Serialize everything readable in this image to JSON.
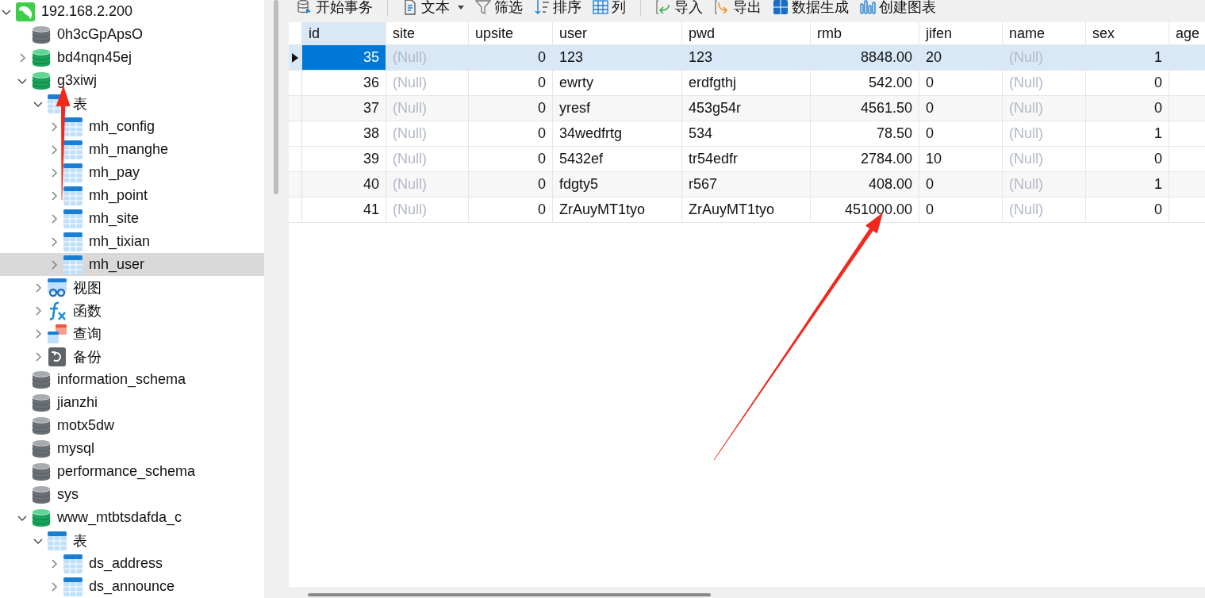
{
  "tree": [
    {
      "label": "192.168.2.200",
      "kind": "server",
      "expanded": true,
      "selected": false,
      "children": [
        {
          "label": "0h3cGpApsO",
          "kind": "database",
          "open": false,
          "selected": false
        },
        {
          "label": "bd4nqn45ej",
          "kind": "database",
          "open": true,
          "expanded": false,
          "selected": false
        },
        {
          "label": "g3xiwj",
          "kind": "database",
          "open": true,
          "expanded": true,
          "selected": false,
          "children": [
            {
              "label": "表",
              "kind": "tables",
              "expanded": true,
              "selected": false,
              "children": [
                {
                  "label": "mh_config",
                  "kind": "table",
                  "expanded": false,
                  "selected": false
                },
                {
                  "label": "mh_manghe",
                  "kind": "table",
                  "expanded": false,
                  "selected": false
                },
                {
                  "label": "mh_pay",
                  "kind": "table",
                  "expanded": false,
                  "selected": false
                },
                {
                  "label": "mh_point",
                  "kind": "table",
                  "expanded": false,
                  "selected": false
                },
                {
                  "label": "mh_site",
                  "kind": "table",
                  "expanded": false,
                  "selected": false
                },
                {
                  "label": "mh_tixian",
                  "kind": "table",
                  "expanded": false,
                  "selected": false
                },
                {
                  "label": "mh_user",
                  "kind": "table",
                  "expanded": false,
                  "selected": true
                }
              ]
            },
            {
              "label": "视图",
              "kind": "views",
              "expanded": false,
              "selected": false
            },
            {
              "label": "函数",
              "kind": "functions",
              "expanded": false,
              "selected": false
            },
            {
              "label": "查询",
              "kind": "queries",
              "expanded": false,
              "selected": false
            },
            {
              "label": "备份",
              "kind": "backups",
              "expanded": false,
              "selected": false
            }
          ]
        },
        {
          "label": "information_schema",
          "kind": "database",
          "open": false,
          "selected": false
        },
        {
          "label": "jianzhi",
          "kind": "database",
          "open": false,
          "selected": false
        },
        {
          "label": "motx5dw",
          "kind": "database",
          "open": false,
          "selected": false
        },
        {
          "label": "mysql",
          "kind": "database",
          "open": false,
          "selected": false
        },
        {
          "label": "performance_schema",
          "kind": "database",
          "open": false,
          "selected": false
        },
        {
          "label": "sys",
          "kind": "database",
          "open": false,
          "selected": false
        },
        {
          "label": "www_mtbtsdafda_c",
          "kind": "database",
          "open": true,
          "expanded": true,
          "selected": false,
          "children": [
            {
              "label": "表",
              "kind": "tables",
              "expanded": true,
              "selected": false,
              "children": [
                {
                  "label": "ds_address",
                  "kind": "table",
                  "expanded": false,
                  "selected": false
                },
                {
                  "label": "ds_announce",
                  "kind": "table",
                  "expanded": false,
                  "selected": false
                }
              ]
            }
          ]
        }
      ]
    }
  ],
  "toolbar": [
    {
      "buttons": [
        {
          "label": "开始事务",
          "kind": "transaction",
          "dropdown": false
        }
      ]
    },
    {
      "buttons": [
        {
          "label": "文本",
          "kind": "text",
          "dropdown": true
        },
        {
          "label": "筛选",
          "kind": "filter",
          "dropdown": false
        },
        {
          "label": "排序",
          "kind": "sort",
          "dropdown": false
        },
        {
          "label": "列",
          "kind": "columns",
          "dropdown": false
        }
      ]
    },
    {
      "buttons": [
        {
          "label": "导入",
          "kind": "import",
          "dropdown": false
        },
        {
          "label": "导出",
          "kind": "export",
          "dropdown": false
        },
        {
          "label": "数据生成",
          "kind": "generate",
          "dropdown": false
        },
        {
          "label": "创建图表",
          "kind": "chart",
          "dropdown": false
        }
      ]
    }
  ],
  "table": {
    "columns": [
      {
        "label": "id",
        "kind": "numeric",
        "selected": true
      },
      {
        "label": "site",
        "kind": "text",
        "selected": false
      },
      {
        "label": "upsite",
        "kind": "numeric",
        "selected": false
      },
      {
        "label": "user",
        "kind": "text",
        "selected": false
      },
      {
        "label": "pwd",
        "kind": "text",
        "selected": false
      },
      {
        "label": "rmb",
        "kind": "numeric",
        "selected": false
      },
      {
        "label": "jifen",
        "kind": "text",
        "selected": false
      },
      {
        "label": "name",
        "kind": "text",
        "selected": false
      },
      {
        "label": "sex",
        "kind": "numeric",
        "selected": false
      },
      {
        "label": "age",
        "kind": "text",
        "selected": false
      }
    ],
    "rows": [
      {
        "selected": true,
        "cells": [
          {
            "text": "35",
            "null": false
          },
          {
            "text": "(Null)",
            "null": true
          },
          {
            "text": "0",
            "null": false
          },
          {
            "text": "123",
            "null": false
          },
          {
            "text": "123",
            "null": false
          },
          {
            "text": "8848.00",
            "null": false
          },
          {
            "text": "20",
            "null": false
          },
          {
            "text": "(Null)",
            "null": true
          },
          {
            "text": "1",
            "null": false
          }
        ]
      },
      {
        "selected": false,
        "cells": [
          {
            "text": "36",
            "null": false
          },
          {
            "text": "(Null)",
            "null": true
          },
          {
            "text": "0",
            "null": false
          },
          {
            "text": "ewrty",
            "null": false
          },
          {
            "text": "erdfgthj",
            "null": false
          },
          {
            "text": "542.00",
            "null": false
          },
          {
            "text": "0",
            "null": false
          },
          {
            "text": "(Null)",
            "null": true
          },
          {
            "text": "0",
            "null": false
          }
        ]
      },
      {
        "selected": false,
        "cells": [
          {
            "text": "37",
            "null": false
          },
          {
            "text": "(Null)",
            "null": true
          },
          {
            "text": "0",
            "null": false
          },
          {
            "text": "yresf",
            "null": false
          },
          {
            "text": "453g54r",
            "null": false
          },
          {
            "text": "4561.50",
            "null": false
          },
          {
            "text": "0",
            "null": false
          },
          {
            "text": "(Null)",
            "null": true
          },
          {
            "text": "0",
            "null": false
          }
        ]
      },
      {
        "selected": false,
        "cells": [
          {
            "text": "38",
            "null": false
          },
          {
            "text": "(Null)",
            "null": true
          },
          {
            "text": "0",
            "null": false
          },
          {
            "text": "34wedfrtg",
            "null": false
          },
          {
            "text": "534",
            "null": false
          },
          {
            "text": "78.50",
            "null": false
          },
          {
            "text": "0",
            "null": false
          },
          {
            "text": "(Null)",
            "null": true
          },
          {
            "text": "1",
            "null": false
          }
        ]
      },
      {
        "selected": false,
        "cells": [
          {
            "text": "39",
            "null": false
          },
          {
            "text": "(Null)",
            "null": true
          },
          {
            "text": "0",
            "null": false
          },
          {
            "text": "5432ef",
            "null": false
          },
          {
            "text": "tr54edfr",
            "null": false
          },
          {
            "text": "2784.00",
            "null": false
          },
          {
            "text": "10",
            "null": false
          },
          {
            "text": "(Null)",
            "null": true
          },
          {
            "text": "0",
            "null": false
          }
        ]
      },
      {
        "selected": false,
        "cells": [
          {
            "text": "40",
            "null": false
          },
          {
            "text": "(Null)",
            "null": true
          },
          {
            "text": "0",
            "null": false
          },
          {
            "text": "fdgty5",
            "null": false
          },
          {
            "text": "r567",
            "null": false
          },
          {
            "text": "408.00",
            "null": false
          },
          {
            "text": "0",
            "null": false
          },
          {
            "text": "(Null)",
            "null": true
          },
          {
            "text": "1",
            "null": false
          }
        ]
      },
      {
        "selected": false,
        "cells": [
          {
            "text": "41",
            "null": false
          },
          {
            "text": "(Null)",
            "null": true
          },
          {
            "text": "0",
            "null": false
          },
          {
            "text": "ZrAuyMT1tyo",
            "null": false
          },
          {
            "text": "ZrAuyMT1tyo",
            "null": false
          },
          {
            "text": "451000.00",
            "null": false
          },
          {
            "text": "0",
            "null": false
          },
          {
            "text": "(Null)",
            "null": true
          },
          {
            "text": "0",
            "null": false
          }
        ]
      }
    ]
  }
}
